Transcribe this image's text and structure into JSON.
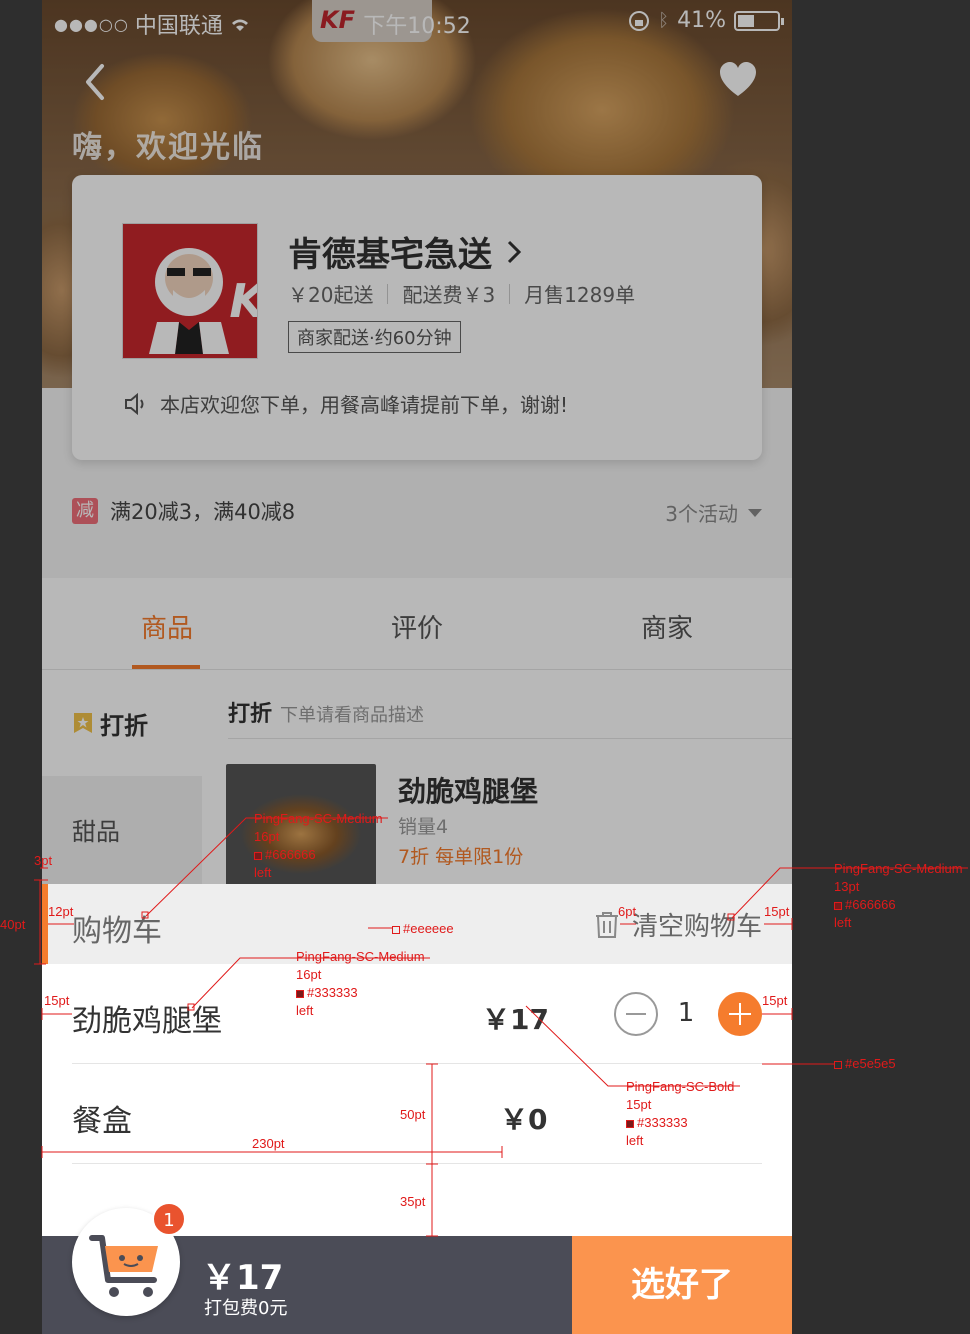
{
  "status_bar": {
    "carrier": "中国联通",
    "time": "下午10:52",
    "battery": "41%"
  },
  "hero": {
    "welcome": "嗨，欢迎光临",
    "cup_brand": "KF"
  },
  "store": {
    "name": "肯德基宅急送",
    "min_order": "￥20起送",
    "delivery_fee": "配送费￥3",
    "monthly_sales": "月售1289单",
    "delivery_tag": "商家配送·约60分钟",
    "notice": "本店欢迎您下单，用餐高峰请提前下单，谢谢!"
  },
  "promo": {
    "badge": "减",
    "text": "满20减3，满40减8",
    "more": "3个活动"
  },
  "tabs": [
    {
      "label": "商品"
    },
    {
      "label": "评价"
    },
    {
      "label": "商家"
    }
  ],
  "sidebar": {
    "items": [
      {
        "label": "打折"
      },
      {
        "label": "甜品"
      }
    ]
  },
  "category": {
    "title": "打折",
    "desc": "下单请看商品描述"
  },
  "food": {
    "name": "劲脆鸡腿堡",
    "sales": "销量4",
    "promo": "7折 每单限1份"
  },
  "cart": {
    "title": "购物车",
    "clear": "清空购物车",
    "items": [
      {
        "name": "劲脆鸡腿堡",
        "price": "￥17",
        "qty": "1"
      },
      {
        "name": "餐盒",
        "price": "￥0"
      }
    ]
  },
  "bottom_bar": {
    "count": "1",
    "total": "￥17",
    "pack_fee": "打包费0元",
    "checkout": "选好了"
  },
  "annotations": {
    "cart_title_spec": [
      "PingFang-SC-Medium",
      "16pt",
      "#666666",
      "left"
    ],
    "clear_spec": [
      "PingFang-SC-Medium",
      "13pt",
      "#666666",
      "left"
    ],
    "item_name_spec": [
      "PingFang-SC-Medium",
      "16pt",
      "#333333",
      "left"
    ],
    "price_spec": [
      "PingFang-SC-Bold",
      "15pt",
      "#333333",
      "left"
    ],
    "bg_color": "#eeeeee",
    "line_color": "#e5e5e5",
    "dims": {
      "d3": "3pt",
      "d40": "40pt",
      "d12": "12pt",
      "d6": "6pt",
      "d15a": "15pt",
      "d15b": "15pt",
      "d15c": "15pt",
      "d15d": "15pt",
      "d50": "50pt",
      "d230": "230pt",
      "d35": "35pt"
    }
  },
  "colors": {
    "accent": "#f57c2d",
    "checkout_bg": "#fb944e",
    "bottom_bg": "#4b4c57",
    "badge": "#e9532e"
  }
}
